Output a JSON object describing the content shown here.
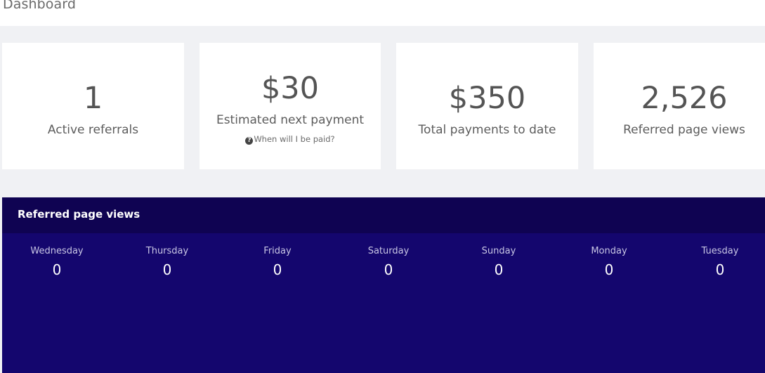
{
  "header": {
    "title": "Dashboard"
  },
  "stats": [
    {
      "value": "1",
      "label": "Active referrals"
    },
    {
      "value": "$30",
      "label": "Estimated next payment",
      "help": "When will I be paid?",
      "help_icon": "question-circle-icon"
    },
    {
      "value": "$350",
      "label": "Total payments to date"
    },
    {
      "value": "2,526",
      "label": "Referred page views"
    }
  ],
  "panel": {
    "title": "Referred page views",
    "days": [
      {
        "name": "Wednesday",
        "value": "0"
      },
      {
        "name": "Thursday",
        "value": "0"
      },
      {
        "name": "Friday",
        "value": "0"
      },
      {
        "name": "Saturday",
        "value": "0"
      },
      {
        "name": "Sunday",
        "value": "0"
      },
      {
        "name": "Monday",
        "value": "0"
      },
      {
        "name": "Tuesday",
        "value": "0"
      }
    ]
  },
  "colors": {
    "page_background": "#f0f1f4",
    "card_background": "#ffffff",
    "panel_background": "#14066e",
    "panel_header_background": "#0f0352",
    "panel_text": "#ffffff"
  }
}
